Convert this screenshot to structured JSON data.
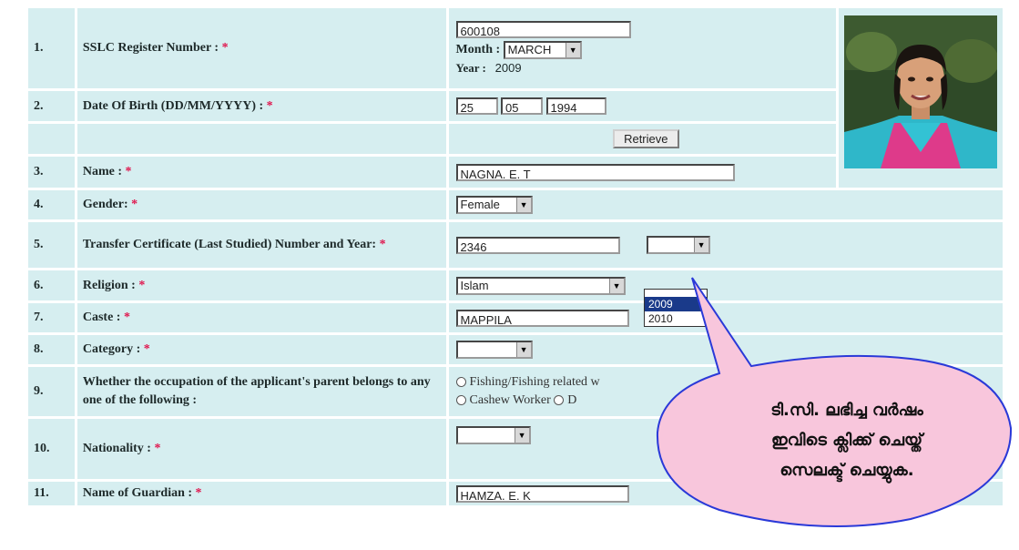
{
  "rows": [
    {
      "num": "1.",
      "label": "SSLC Register Number :",
      "req": "*"
    },
    {
      "num": "2.",
      "label": "Date Of Birth (DD/MM/YYYY) :",
      "req": "*"
    },
    {
      "num": "",
      "label": "",
      "req": ""
    },
    {
      "num": "3.",
      "label": "Name :",
      "req": "*"
    },
    {
      "num": "4.",
      "label": "Gender:",
      "req": "*"
    },
    {
      "num": "5.",
      "label": "Transfer Certificate (Last Studied) Number and Year:",
      "req": "*"
    },
    {
      "num": "6.",
      "label": "Religion :",
      "req": "*"
    },
    {
      "num": "7.",
      "label": "Caste :",
      "req": "*"
    },
    {
      "num": "8.",
      "label": "Category :",
      "req": "*"
    },
    {
      "num": "9.",
      "label": "Whether the occupation of the applicant's parent belongs to any one of the following :",
      "req": ""
    },
    {
      "num": "10.",
      "label": "Nationality :",
      "req": "*"
    },
    {
      "num": "11.",
      "label": "Name of Guardian :",
      "req": "*"
    }
  ],
  "fields": {
    "register_number": "600108",
    "month_label": "Month :",
    "month_value": "MARCH",
    "year_label": "Year :",
    "year_value": "2009",
    "dob_day": "25",
    "dob_month": "05",
    "dob_year": "1994",
    "retrieve_label": "Retrieve",
    "name": "NAGNA. E. T",
    "gender": "Female",
    "tc_number": "2346",
    "tc_year": "",
    "religion": "Islam",
    "caste": "MAPPILA",
    "category": "",
    "occupation_option1": "Fishing/Fishing related w",
    "occupation_option2": "Cashew Worker",
    "occupation_option3": "D",
    "nationality": "",
    "guardian": "HAMZA. E. K"
  },
  "tc_year_options": [
    "2009",
    "2010"
  ],
  "callout": {
    "line1": "ടി.സി. ലഭിച്ച വർഷം",
    "line2": "ഇവിടെ ക്ലിക്ക് ചെയ്ത്",
    "line3": "സെലക്ട് ചെയ്യുക."
  },
  "colors": {
    "row_bg": "#d6eef0",
    "required": "#e0144c",
    "callout_fill": "#f8c6dc",
    "callout_stroke": "#2a39d8"
  }
}
